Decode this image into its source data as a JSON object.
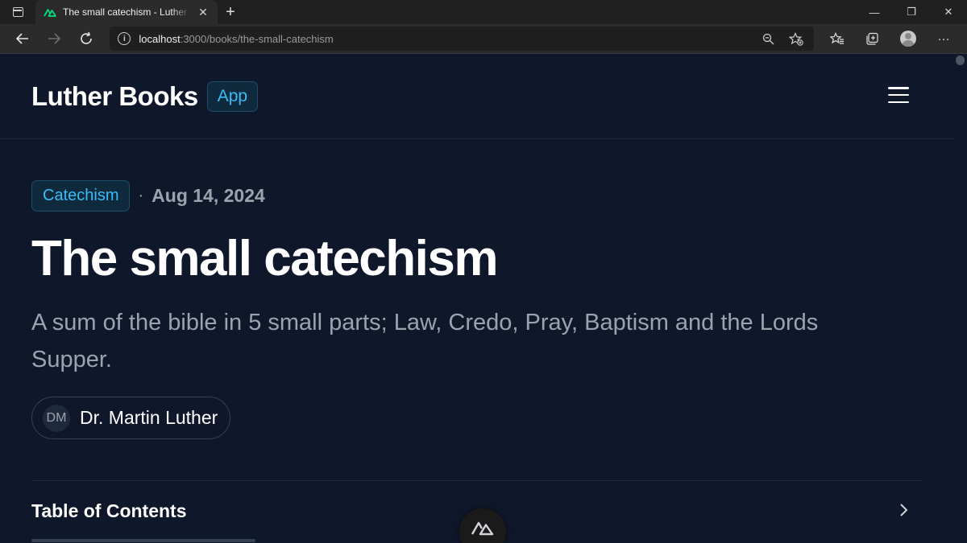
{
  "browser": {
    "tab_title": "The small catechism - Luther Books",
    "url_host": "localhost",
    "url_path": ":3000/books/the-small-catechism"
  },
  "header": {
    "brand": "Luther Books",
    "badge": "App"
  },
  "book": {
    "category": "Catechism",
    "separator": "·",
    "date": "Aug 14, 2024",
    "title": "The small catechism",
    "description": "A sum of the bible in 5 small parts; Law, Credo, Pray, Baptism and the Lords Supper.",
    "author_initials": "DM",
    "author_name": "Dr. Martin Luther"
  },
  "toc": {
    "title": "Table of Contents"
  },
  "colors": {
    "background": "#0f172a",
    "accent": "#38bdf8",
    "nuxt_green": "#00dc82"
  }
}
